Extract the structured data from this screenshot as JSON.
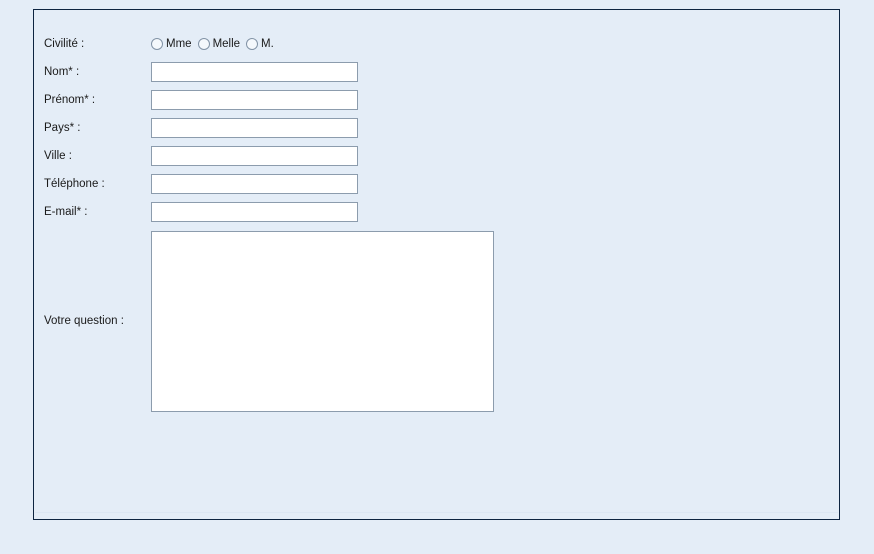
{
  "page": {
    "background_color": "#e4edf7",
    "panel_border_color": "#0d2440",
    "field_border_color": "#8c9cad",
    "field_background_color": "#ffffff",
    "text_color": "#1a1a1a"
  },
  "form": {
    "rows": [
      {
        "label": "Civilité :",
        "type": "radio"
      },
      {
        "label": "Nom* :",
        "type": "text",
        "value": "",
        "placeholder": ""
      },
      {
        "label": "Prénom* :",
        "type": "text",
        "value": "",
        "placeholder": ""
      },
      {
        "label": "Pays* :",
        "type": "text",
        "value": "",
        "placeholder": ""
      },
      {
        "label": "Ville :",
        "type": "text",
        "value": "",
        "placeholder": ""
      },
      {
        "label": "Téléphone :",
        "type": "text",
        "value": "",
        "placeholder": ""
      },
      {
        "label": "E-mail* :",
        "type": "text",
        "value": "",
        "placeholder": ""
      },
      {
        "label": "Votre question :",
        "type": "textarea",
        "value": "",
        "placeholder": ""
      }
    ],
    "civility_options": [
      {
        "label": "Mme",
        "selected": false
      },
      {
        "label": "Melle",
        "selected": false
      },
      {
        "label": "M.",
        "selected": false
      }
    ]
  }
}
